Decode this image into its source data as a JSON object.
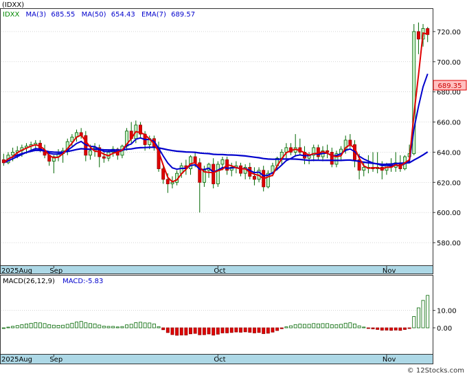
{
  "ticker_label": "(IDXX)",
  "legend": {
    "symbol": "IDXX",
    "ma3": "MA(3)",
    "ma3_value": "685.55",
    "ma50": "MA(50)",
    "ma50_value": "654.43",
    "ema7": "EMA(7)",
    "ema7_value": "689.57"
  },
  "last_price_label": "689.35",
  "macd_legend": {
    "name": "MACD(26,12,9)",
    "value_label": "MACD:-5.83"
  },
  "watermark": "© 12Stocks.com",
  "colors": {
    "up_candle": "#c8f0c8",
    "down_candle": "#e00000",
    "ma_short": "#e00000",
    "ma_long": "#0000cc",
    "macd_pos": "#006600",
    "macd_neg": "#e00000",
    "axis_band": "#add8e6",
    "legend_text": "#0000cc"
  },
  "chart_data": [
    {
      "type": "candlestick",
      "title": "(IDXX)",
      "ylim": [
        565,
        735
      ],
      "y_ticks": [
        580,
        600,
        620,
        640,
        660,
        680,
        700,
        720
      ],
      "y_tick_labels": [
        "580.00",
        "600.00",
        "620.00",
        "640.00",
        "660.00",
        "680.00",
        "700.00",
        "720.00"
      ],
      "x_labels": [
        {
          "index": 0,
          "label": "2025Aug"
        },
        {
          "index": 11,
          "label": "Sep"
        },
        {
          "index": 47,
          "label": "Oct"
        },
        {
          "index": 84,
          "label": "Nov"
        }
      ],
      "ohlc": [
        [
          635,
          639,
          631,
          633
        ],
        [
          633,
          640,
          632,
          638
        ],
        [
          638,
          643,
          634,
          640
        ],
        [
          640,
          644,
          636,
          641
        ],
        [
          641,
          645,
          637,
          643
        ],
        [
          643,
          646,
          639,
          644
        ],
        [
          644,
          647,
          640,
          645
        ],
        [
          645,
          648,
          641,
          646
        ],
        [
          646,
          648,
          640,
          641
        ],
        [
          641,
          645,
          636,
          638
        ],
        [
          638,
          640,
          631,
          634
        ],
        [
          634,
          638,
          626,
          637
        ],
        [
          637,
          642,
          634,
          639
        ],
        [
          639,
          643,
          633,
          641
        ],
        [
          641,
          649,
          638,
          647
        ],
        [
          647,
          652,
          644,
          650
        ],
        [
          650,
          655,
          647,
          653
        ],
        [
          653,
          656,
          649,
          651
        ],
        [
          651,
          654,
          634,
          638
        ],
        [
          638,
          645,
          635,
          641
        ],
        [
          641,
          646,
          637,
          643
        ],
        [
          643,
          645,
          630,
          637
        ],
        [
          637,
          641,
          633,
          636
        ],
        [
          636,
          642,
          634,
          640
        ],
        [
          640,
          644,
          637,
          642
        ],
        [
          642,
          643,
          635,
          638
        ],
        [
          638,
          645,
          636,
          644
        ],
        [
          644,
          656,
          641,
          654
        ],
        [
          654,
          660,
          646,
          649
        ],
        [
          649,
          661,
          646,
          658
        ],
        [
          658,
          660,
          649,
          652
        ],
        [
          652,
          654,
          641,
          645
        ],
        [
          645,
          651,
          642,
          649
        ],
        [
          649,
          651,
          641,
          643
        ],
        [
          643,
          647,
          627,
          629
        ],
        [
          629,
          632,
          619,
          622
        ],
        [
          622,
          626,
          613,
          619
        ],
        [
          619,
          624,
          616,
          620
        ],
        [
          620,
          628,
          618,
          626
        ],
        [
          626,
          633,
          623,
          631
        ],
        [
          631,
          635,
          625,
          629
        ],
        [
          629,
          638,
          625,
          637
        ],
        [
          637,
          640,
          630,
          633
        ],
        [
          633,
          636,
          600,
          620
        ],
        [
          620,
          631,
          617,
          628
        ],
        [
          628,
          633,
          623,
          632
        ],
        [
          632,
          636,
          616,
          619
        ],
        [
          619,
          634,
          617,
          632
        ],
        [
          632,
          637,
          628,
          635
        ],
        [
          635,
          637,
          625,
          628
        ],
        [
          628,
          633,
          624,
          630
        ],
        [
          630,
          634,
          626,
          631
        ],
        [
          631,
          633,
          624,
          626
        ],
        [
          626,
          632,
          622,
          630
        ],
        [
          630,
          633,
          622,
          624
        ],
        [
          624,
          630,
          618,
          622
        ],
        [
          622,
          630,
          620,
          628
        ],
        [
          628,
          631,
          614,
          617
        ],
        [
          617,
          628,
          616,
          626
        ],
        [
          626,
          633,
          624,
          631
        ],
        [
          631,
          637,
          628,
          636
        ],
        [
          636,
          642,
          632,
          640
        ],
        [
          640,
          646,
          636,
          643
        ],
        [
          643,
          646,
          638,
          640
        ],
        [
          640,
          652,
          637,
          643
        ],
        [
          643,
          649,
          638,
          640
        ],
        [
          640,
          644,
          632,
          636
        ],
        [
          636,
          640,
          632,
          638
        ],
        [
          638,
          645,
          634,
          643
        ],
        [
          643,
          645,
          635,
          637
        ],
        [
          637,
          644,
          634,
          641
        ],
        [
          641,
          645,
          636,
          640
        ],
        [
          640,
          643,
          630,
          632
        ],
        [
          632,
          641,
          630,
          639
        ],
        [
          639,
          644,
          634,
          642
        ],
        [
          642,
          651,
          639,
          648
        ],
        [
          648,
          652,
          643,
          645
        ],
        [
          645,
          648,
          630,
          635
        ],
        [
          635,
          639,
          622,
          628
        ],
        [
          628,
          633,
          624,
          630
        ],
        [
          630,
          638,
          626,
          630
        ],
        [
          630,
          640,
          627,
          629
        ],
        [
          629,
          640,
          626,
          630
        ],
        [
          630,
          634,
          622,
          628
        ],
        [
          628,
          633,
          625,
          632
        ],
        [
          632,
          636,
          627,
          630
        ],
        [
          630,
          640,
          627,
          633
        ],
        [
          633,
          638,
          627,
          629
        ],
        [
          629,
          638,
          628,
          637
        ],
        [
          637,
          645,
          634,
          639
        ],
        [
          639,
          725,
          638,
          720
        ],
        [
          720,
          726,
          705,
          715
        ],
        [
          715,
          725,
          710,
          722
        ],
        [
          722,
          723,
          713,
          718
        ]
      ]
    },
    {
      "type": "bar",
      "title": "MACD(26,12,9)",
      "ylim": [
        -15,
        30
      ],
      "y_ticks": [
        0,
        10
      ],
      "y_tick_labels": [
        "0.00",
        "10.00"
      ]
    }
  ]
}
